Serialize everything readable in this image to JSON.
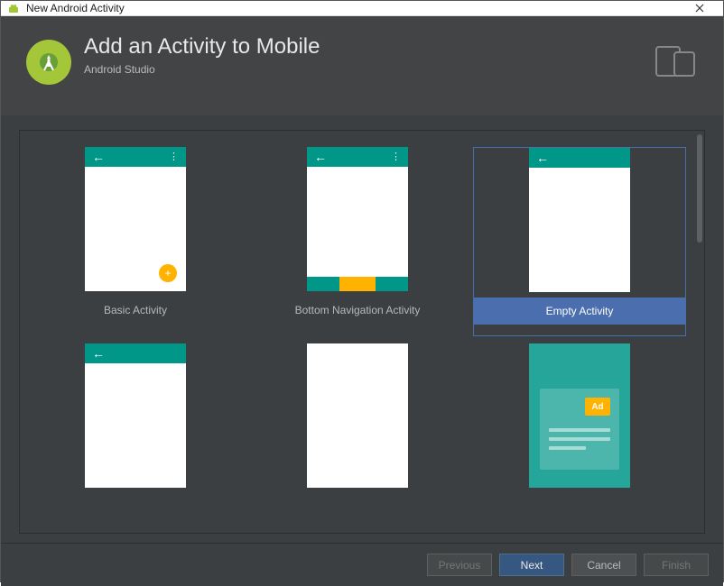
{
  "window": {
    "title": "New Android Activity"
  },
  "header": {
    "title": "Add an Activity to Mobile",
    "subtitle": "Android Studio"
  },
  "templates": [
    {
      "label": "Basic Activity",
      "selected": false
    },
    {
      "label": "Bottom Navigation Activity",
      "selected": false
    },
    {
      "label": "Empty Activity",
      "selected": true
    },
    {
      "label": "",
      "selected": false
    },
    {
      "label": "",
      "selected": false
    },
    {
      "label": "",
      "selected": false
    }
  ],
  "ad_badge": "Ad",
  "buttons": {
    "previous": "Previous",
    "next": "Next",
    "cancel": "Cancel",
    "finish": "Finish"
  }
}
